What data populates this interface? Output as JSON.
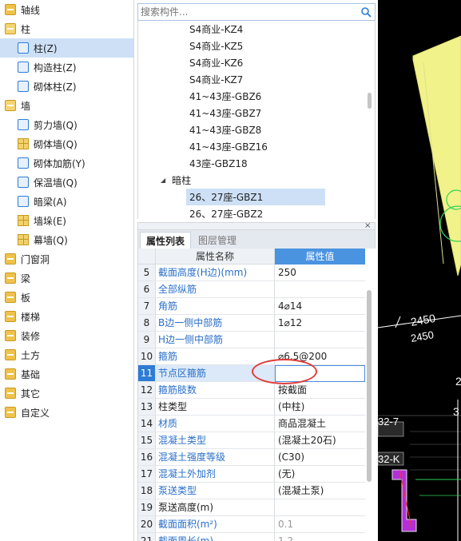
{
  "tree": {
    "items": [
      {
        "label": "轴线",
        "level": 0,
        "icon": "folder-icon",
        "selected": false
      },
      {
        "label": "柱",
        "level": 0,
        "icon": "folder-open-icon",
        "selected": false
      },
      {
        "label": "柱(Z)",
        "level": 1,
        "icon": "column-icon",
        "selected": true
      },
      {
        "label": "构造柱(Z)",
        "level": 1,
        "icon": "structural-column-icon",
        "selected": false
      },
      {
        "label": "砌体柱(Z)",
        "level": 1,
        "icon": "masonry-column-icon",
        "selected": false
      },
      {
        "label": "墙",
        "level": 0,
        "icon": "folder-open-icon",
        "selected": false
      },
      {
        "label": "剪力墙(Q)",
        "level": 1,
        "icon": "shear-wall-icon",
        "selected": false
      },
      {
        "label": "砌体墙(Q)",
        "level": 1,
        "icon": "masonry-wall-icon",
        "selected": false
      },
      {
        "label": "砌体加筋(Y)",
        "level": 1,
        "icon": "masonry-rebar-icon",
        "selected": false
      },
      {
        "label": "保温墙(Q)",
        "level": 1,
        "icon": "insulation-wall-icon",
        "selected": false
      },
      {
        "label": "暗梁(A)",
        "level": 1,
        "icon": "hidden-beam-icon",
        "selected": false
      },
      {
        "label": "墙垛(E)",
        "level": 1,
        "icon": "wall-pier-icon",
        "selected": false
      },
      {
        "label": "幕墙(Q)",
        "level": 1,
        "icon": "curtain-wall-icon",
        "selected": false
      },
      {
        "label": "门窗洞",
        "level": 0,
        "icon": "folder-icon",
        "selected": false
      },
      {
        "label": "梁",
        "level": 0,
        "icon": "folder-icon",
        "selected": false
      },
      {
        "label": "板",
        "level": 0,
        "icon": "folder-icon",
        "selected": false
      },
      {
        "label": "楼梯",
        "level": 0,
        "icon": "folder-icon",
        "selected": false
      },
      {
        "label": "装修",
        "level": 0,
        "icon": "folder-icon",
        "selected": false
      },
      {
        "label": "土方",
        "level": 0,
        "icon": "folder-icon",
        "selected": false
      },
      {
        "label": "基础",
        "level": 0,
        "icon": "folder-icon",
        "selected": false
      },
      {
        "label": "其它",
        "level": 0,
        "icon": "folder-icon",
        "selected": false
      },
      {
        "label": "自定义",
        "level": 0,
        "icon": "folder-icon",
        "selected": false
      }
    ]
  },
  "search": {
    "placeholder": "搜索构件..."
  },
  "components": {
    "items": [
      {
        "label": "S4商业-KZ4",
        "type": "item",
        "selected": false
      },
      {
        "label": "S4商业-KZ5",
        "type": "item",
        "selected": false
      },
      {
        "label": "S4商业-KZ6",
        "type": "item",
        "selected": false
      },
      {
        "label": "S4商业-KZ7",
        "type": "item",
        "selected": false
      },
      {
        "label": "41~43座-GBZ6",
        "type": "item",
        "selected": false
      },
      {
        "label": "41~43座-GBZ7",
        "type": "item",
        "selected": false
      },
      {
        "label": "41~43座-GBZ8",
        "type": "item",
        "selected": false
      },
      {
        "label": "41~43座-GBZ16",
        "type": "item",
        "selected": false
      },
      {
        "label": "43座-GBZ18",
        "type": "item",
        "selected": false
      },
      {
        "label": "暗柱",
        "type": "group",
        "selected": false
      },
      {
        "label": "26、27座-GBZ1",
        "type": "item",
        "selected": true
      },
      {
        "label": "26、27座-GBZ2",
        "type": "item",
        "selected": false
      }
    ]
  },
  "panel": {
    "close_label": "×",
    "tabs": [
      {
        "label": "属性列表",
        "active": true
      },
      {
        "label": "图层管理",
        "active": false
      }
    ],
    "header": {
      "name": "属性名称",
      "value": "属性值"
    },
    "rows": [
      {
        "num": "5",
        "name": "截面高度(H边)(mm)",
        "value": "250",
        "color": "blue",
        "value_gray": false,
        "highlight": false
      },
      {
        "num": "6",
        "name": "全部纵筋",
        "value": "",
        "color": "blue",
        "value_gray": false,
        "highlight": false
      },
      {
        "num": "7",
        "name": "角筋",
        "value": "4⌀14",
        "color": "blue",
        "value_gray": false,
        "highlight": false
      },
      {
        "num": "8",
        "name": "B边一侧中部筋",
        "value": "1⌀12",
        "color": "blue",
        "value_gray": false,
        "highlight": false
      },
      {
        "num": "9",
        "name": "H边一侧中部筋",
        "value": "",
        "color": "blue",
        "value_gray": false,
        "highlight": false
      },
      {
        "num": "10",
        "name": "箍筋",
        "value": "⌀6.5@200",
        "color": "blue",
        "value_gray": false,
        "highlight": false
      },
      {
        "num": "11",
        "name": "节点区箍筋",
        "value": "",
        "color": "blue",
        "value_gray": false,
        "highlight": true
      },
      {
        "num": "12",
        "name": "箍筋肢数",
        "value": "按截面",
        "color": "blue",
        "value_gray": false,
        "highlight": false
      },
      {
        "num": "13",
        "name": "柱类型",
        "value": "(中柱)",
        "color": "dark",
        "value_gray": false,
        "highlight": false
      },
      {
        "num": "14",
        "name": "材质",
        "value": "商品混凝土",
        "color": "blue",
        "value_gray": false,
        "highlight": false
      },
      {
        "num": "15",
        "name": "混凝土类型",
        "value": "(混凝土20石)",
        "color": "blue",
        "value_gray": false,
        "highlight": false
      },
      {
        "num": "16",
        "name": "混凝土强度等级",
        "value": "(C30)",
        "color": "blue",
        "value_gray": false,
        "highlight": false
      },
      {
        "num": "17",
        "name": "混凝土外加剂",
        "value": "(无)",
        "color": "blue",
        "value_gray": false,
        "highlight": false
      },
      {
        "num": "18",
        "name": "泵送类型",
        "value": "(混凝土泵)",
        "color": "blue",
        "value_gray": false,
        "highlight": false
      },
      {
        "num": "19",
        "name": "泵送高度(m)",
        "value": "",
        "color": "dark",
        "value_gray": false,
        "highlight": false
      },
      {
        "num": "20",
        "name": "截面面积(m²)",
        "value": "0.1",
        "color": "blue",
        "value_gray": true,
        "highlight": false
      },
      {
        "num": "21",
        "name": "截面周长(m)",
        "value": "1.2",
        "color": "blue",
        "value_gray": true,
        "highlight": false
      }
    ]
  },
  "cad": {
    "dim_top": "2450",
    "dim_bottom": "2450",
    "label_a": "32-7",
    "label_b": "32-K",
    "label_c": "2",
    "label_d": "3"
  },
  "colors": {
    "accent": "#2e7bd6",
    "selected_bg": "#cde0f6",
    "annotation": "#e23b3b",
    "cad_bg": "#000000",
    "cad_yellow": "#f2f28a",
    "cad_green": "#2fd35a",
    "cad_purple": "#b42fd8"
  }
}
